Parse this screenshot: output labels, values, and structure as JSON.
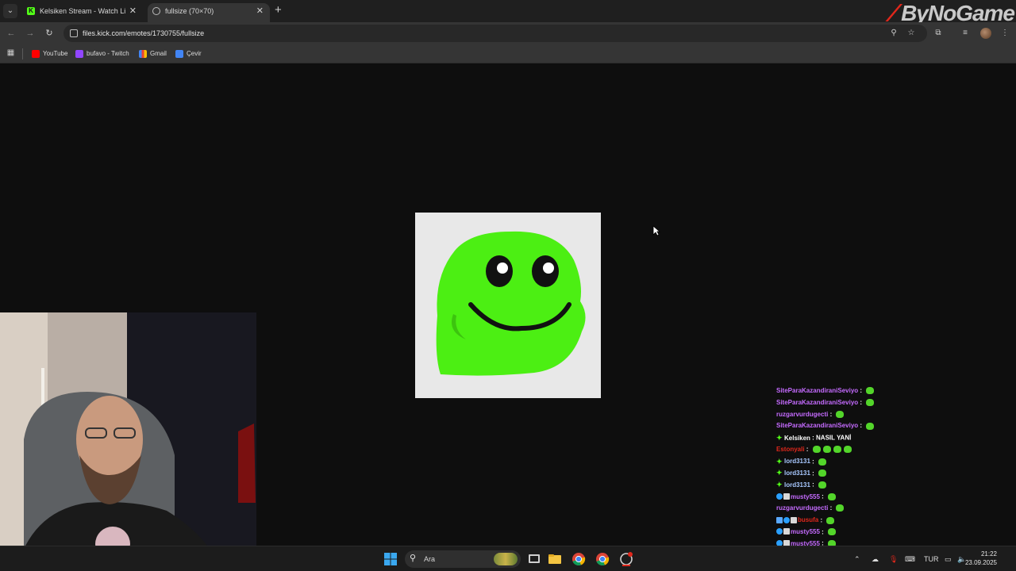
{
  "browser": {
    "tabs": [
      {
        "title": "Kelsiken Stream - Watch Live o",
        "active": false
      },
      {
        "title": "fullsize (70×70)",
        "active": true
      }
    ],
    "address": "files.kick.com/emotes/1730755/fullsize",
    "bookmarks": [
      "YouTube",
      "bufavo - Twitch",
      "Gmail",
      "Çevir"
    ]
  },
  "watermark": {
    "text": "ByNoGame"
  },
  "chat": [
    {
      "badges": [],
      "name": "SiteParaKazandiraniSeviyo",
      "color": "#c56bff",
      "emotes": 1
    },
    {
      "badges": [],
      "name": "SiteParaKazandiraniSeviyo",
      "color": "#c56bff",
      "emotes": 1
    },
    {
      "badges": [],
      "name": "ruzgarvurdugecti",
      "color": "#c56bff",
      "emotes": 1
    },
    {
      "badges": [],
      "name": "SiteParaKazandiraniSeviyo",
      "color": "#c56bff",
      "emotes": 1
    },
    {
      "badges": [
        "star"
      ],
      "name": "Kelsiken",
      "color": "#ffffff",
      "message": "NASIL YANİ",
      "emotes": 0
    },
    {
      "badges": [],
      "name": "Estonyali",
      "color": "#e0271b",
      "emotes": 4
    },
    {
      "badges": [
        "star"
      ],
      "name": "lord3131",
      "color": "#a8c8ff",
      "emotes": 1
    },
    {
      "badges": [
        "star"
      ],
      "name": "lord3131",
      "color": "#a8c8ff",
      "emotes": 1
    },
    {
      "badges": [
        "star"
      ],
      "name": "lord3131",
      "color": "#a8c8ff",
      "emotes": 1
    },
    {
      "badges": [
        "blue",
        "box"
      ],
      "name": "musty555",
      "color": "#c56bff",
      "emotes": 1
    },
    {
      "badges": [],
      "name": "ruzgarvurdugecti",
      "color": "#c56bff",
      "emotes": 1
    },
    {
      "badges": [
        "sub",
        "blue",
        "box"
      ],
      "name": "busufa",
      "color": "#e0271b",
      "emotes": 1
    },
    {
      "badges": [
        "blue",
        "box"
      ],
      "name": "musty555",
      "color": "#c56bff",
      "emotes": 1
    },
    {
      "badges": [
        "blue",
        "box"
      ],
      "name": "musty555",
      "color": "#c56bff",
      "emotes": 1
    }
  ],
  "taskbar": {
    "search_placeholder": "Ara",
    "language": "TUR",
    "time": "21:22",
    "date": "23.09.2025"
  }
}
